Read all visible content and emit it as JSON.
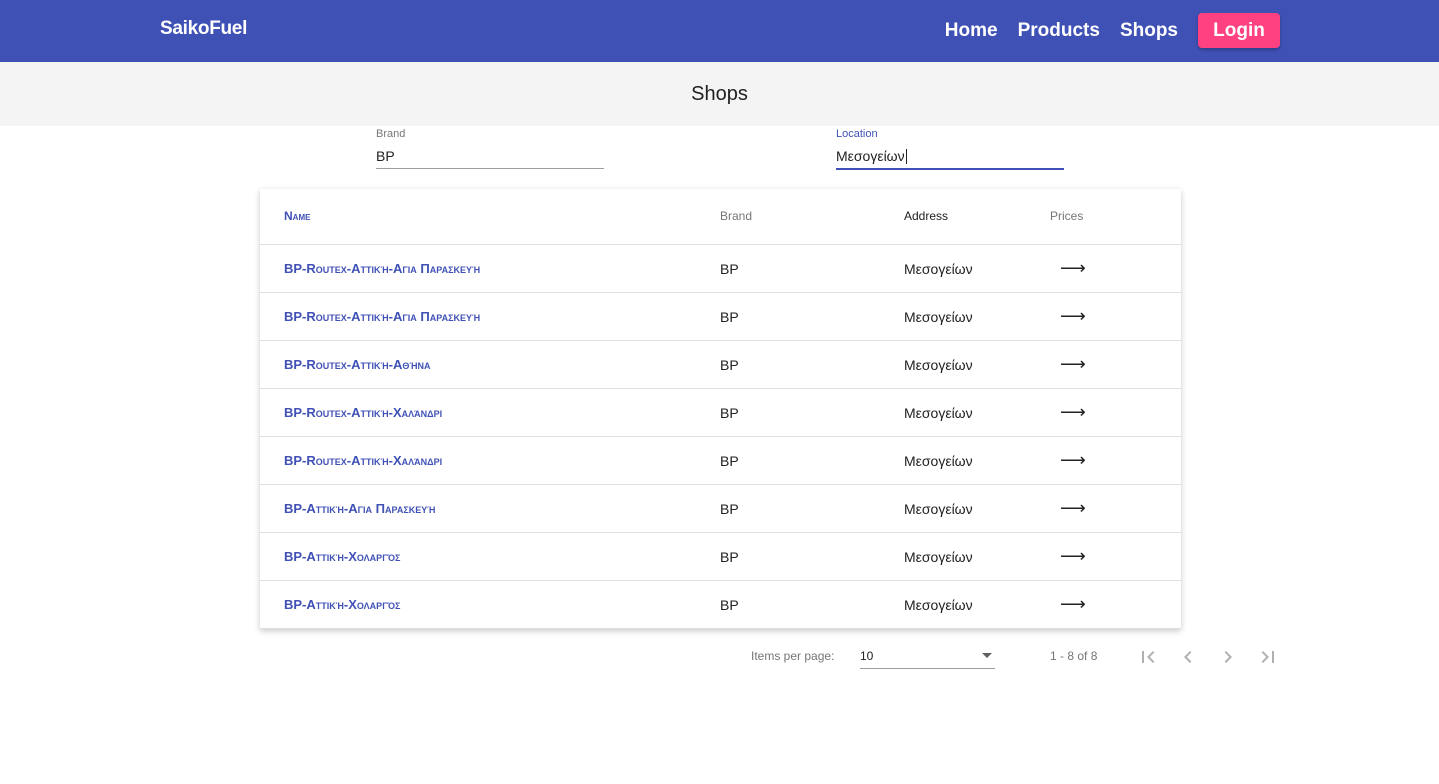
{
  "header": {
    "brand": "SaikoFuel",
    "nav": [
      "Home",
      "Products",
      "Shops"
    ],
    "login_label": "Login"
  },
  "page": {
    "title": "Shops"
  },
  "filters": {
    "brand": {
      "label": "Brand",
      "value": "BP"
    },
    "location": {
      "label": "Location",
      "value": "Μεσογείων"
    }
  },
  "table": {
    "headers": {
      "name": "Name",
      "brand": "Brand",
      "address": "Address",
      "prices": "Prices"
    },
    "rows": [
      {
        "name": "BP-Routex-Αττική-Αγια Παρασκευή",
        "brand": "BP",
        "address": "Μεσογείων",
        "prices": "⟶"
      },
      {
        "name": "BP-Routex-Αττική-Αγια Παρασκευή",
        "brand": "BP",
        "address": "Μεσογείων",
        "prices": "⟶"
      },
      {
        "name": "BP-Routex-Αττική-Αθήνα",
        "brand": "BP",
        "address": "Μεσογείων",
        "prices": "⟶"
      },
      {
        "name": "BP-Routex-Αττική-Χαλάνδρι",
        "brand": "BP",
        "address": "Μεσογείων",
        "prices": "⟶"
      },
      {
        "name": "BP-Routex-Αττική-Χαλάνδρι",
        "brand": "BP",
        "address": "Μεσογείων",
        "prices": "⟶"
      },
      {
        "name": "BP-Αττική-Αγια Παρασκευή",
        "brand": "BP",
        "address": "Μεσογείων",
        "prices": "⟶"
      },
      {
        "name": "BP-Αττική-Χολαργός",
        "brand": "BP",
        "address": "Μεσογείων",
        "prices": "⟶"
      },
      {
        "name": "BP-Αττική-Χολαργός",
        "brand": "BP",
        "address": "Μεσογείων",
        "prices": "⟶"
      }
    ]
  },
  "paginator": {
    "items_per_page_label": "Items per page:",
    "page_size": "10",
    "range_label": "1 - 8 of 8",
    "icons": [
      "first-page-icon",
      "previous-page-icon",
      "next-page-icon",
      "last-page-icon"
    ]
  },
  "colors": {
    "primary": "#3f51b5",
    "accent": "#ff4081"
  }
}
